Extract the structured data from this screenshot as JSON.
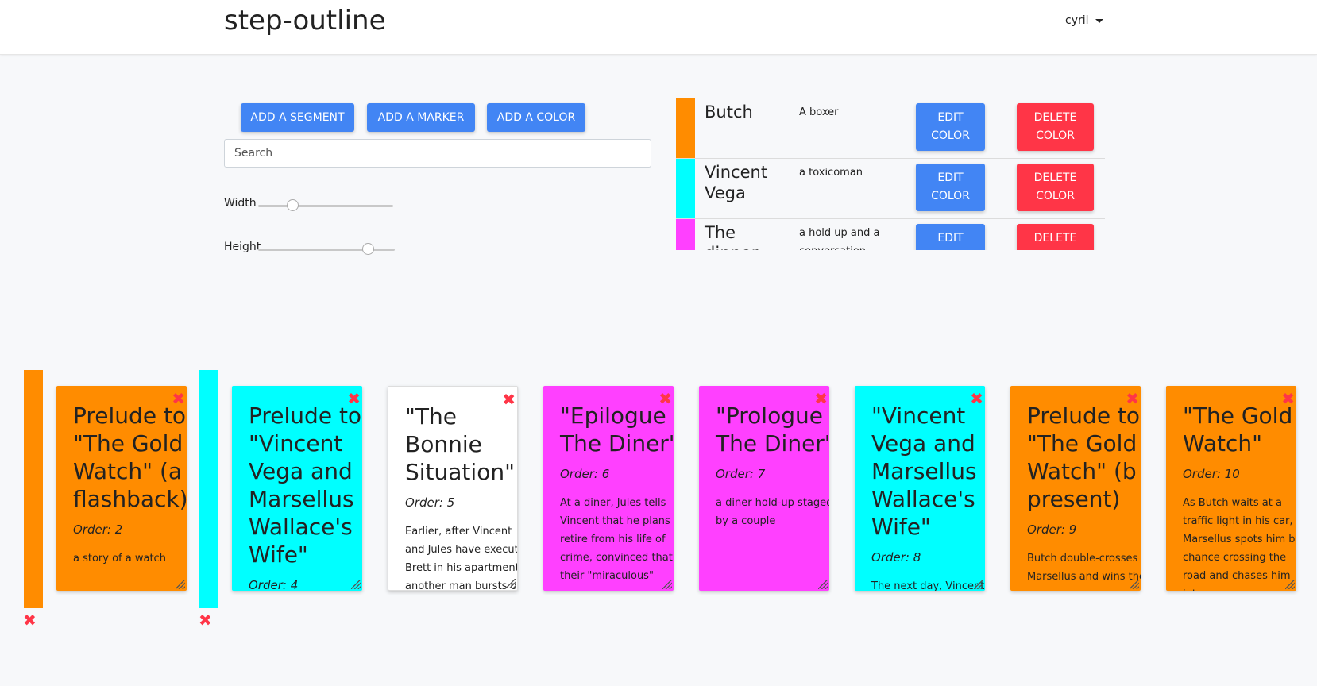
{
  "navbar": {
    "brand": "step-outline",
    "user": "cyril"
  },
  "toolbar": {
    "add_segment": "ADD A SEGMENT",
    "add_marker": "ADD A MARKER",
    "add_color": "ADD A COLOR",
    "search_placeholder": "Search",
    "width_label": "Width",
    "height_label": "Height",
    "width_value": 0.25,
    "height_value": 0.8
  },
  "colors": [
    {
      "name": "Butch",
      "description": "A boxer",
      "color": "#ff8c00",
      "edit": "EDIT COLOR",
      "delete": "DELETE COLOR"
    },
    {
      "name": "Vincent Vega",
      "description": "a toxicoman",
      "color": "#00ffff",
      "edit": "EDIT COLOR",
      "delete": "DELETE COLOR"
    },
    {
      "name": "The dinner",
      "description": "a hold up and a conversation",
      "color": "#ff40ff",
      "edit": "EDIT",
      "delete": "DELETE"
    }
  ],
  "markers": [
    {
      "color": "#ff8c00"
    },
    {
      "color": "#00ffff"
    }
  ],
  "segments": [
    {
      "title": "Prelude to \"The Gold Watch\" (a - flashback)",
      "order": "Order: 2",
      "description": "a story of a watch",
      "color": "#ff8c00"
    },
    {
      "title": "Prelude to \"Vincent Vega and Marsellus Wallace's Wife\"",
      "order": "Order: 4",
      "description": "",
      "color": "#00ffff"
    },
    {
      "title": "\"The Bonnie Situation\"",
      "order": "Order: 5",
      "description": "Earlier, after Vincent and Jules have executed Brett in his apartment, another man bursts out of the bathroom and",
      "color": "#ffffff"
    },
    {
      "title": "\"Epilogue – The Diner\"",
      "order": "Order: 6",
      "description": "At a diner, Jules tells Vincent that he plans to retire from his life of crime, convinced that their \"miraculous\"",
      "color": "#ff40ff"
    },
    {
      "title": "\"Prologue – The Diner\"",
      "order": "Order: 7",
      "description": "a diner hold-up staged by a couple",
      "color": "#ff40ff"
    },
    {
      "title": "\"Vincent Vega and Marsellus Wallace's Wife\"",
      "order": "Order: 8",
      "description": "The next day, Vincent",
      "color": "#00ffff"
    },
    {
      "title": "Prelude to \"The Gold Watch\" (b - present)",
      "order": "Order: 9",
      "description": "Butch double-crosses Marsellus and wins the",
      "color": "#ff8c00"
    },
    {
      "title": "\"The Gold Watch\"",
      "order": "Order: 10",
      "description": "As Butch waits at a traffic light in his car, Marsellus spots him by chance crossing the road and chases him into a",
      "color": "#ff8c00"
    }
  ],
  "icons": {
    "close": "×",
    "remove": "✖"
  }
}
